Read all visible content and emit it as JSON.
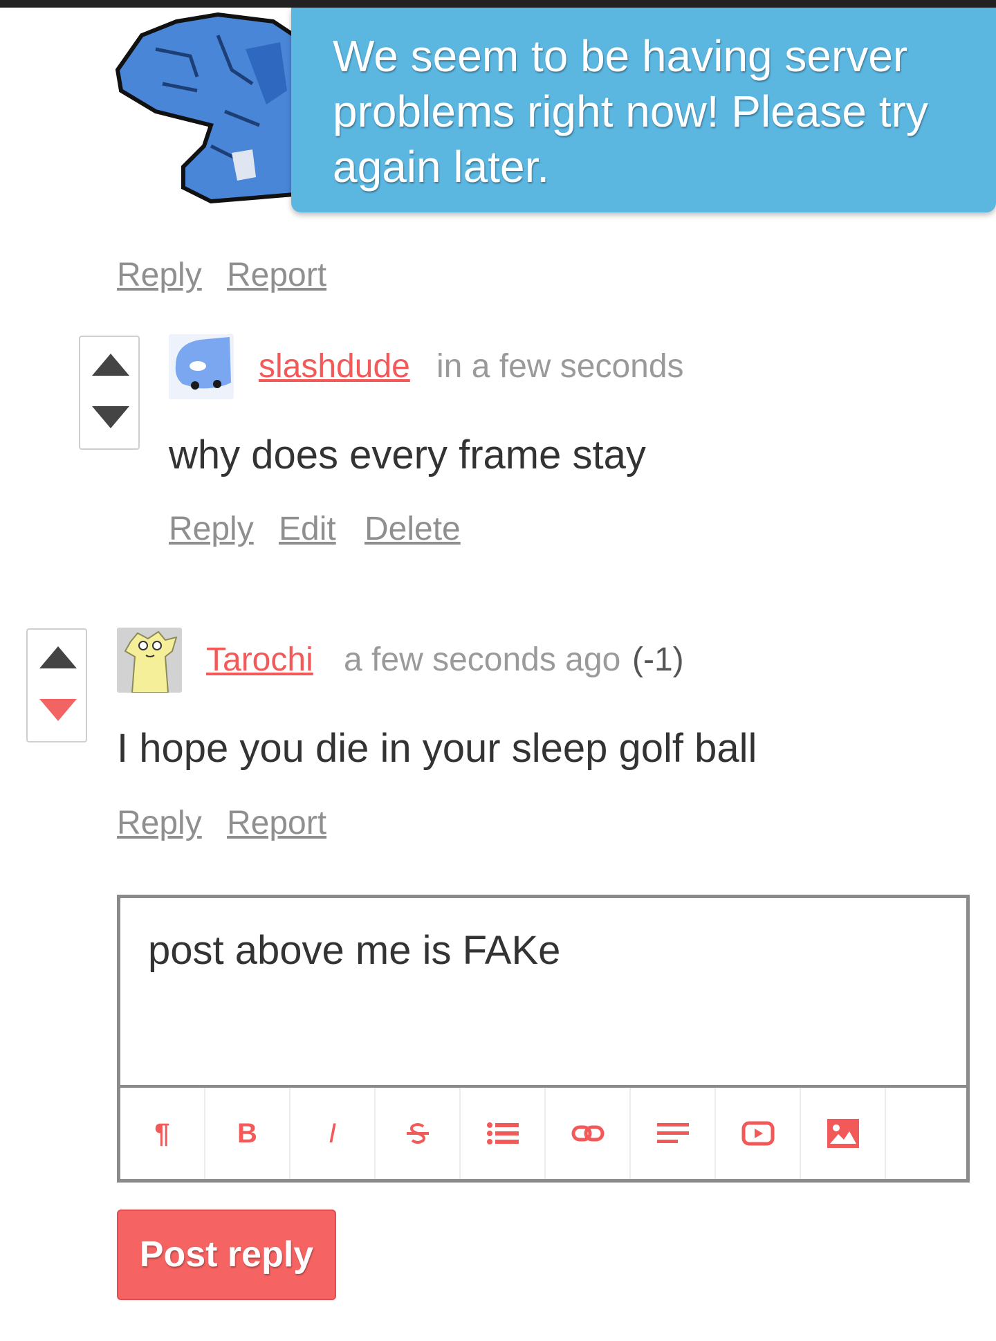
{
  "toast": {
    "message": "We seem to be having server problems right now! Please try again later."
  },
  "comment_prev": {
    "reply_label": "Reply",
    "report_label": "Report"
  },
  "comment_slashdude": {
    "username": "slashdude",
    "time": "in a few seconds",
    "text": "why does every frame stay",
    "reply_label": "Reply",
    "edit_label": "Edit",
    "delete_label": "Delete"
  },
  "comment_tarochi": {
    "username": "Tarochi",
    "time": "a few seconds ago",
    "score": "(-1)",
    "text": "I hope you die in your sleep golf ball",
    "reply_label": "Reply",
    "report_label": "Report"
  },
  "reply_box": {
    "value": "post above me is FAKe",
    "toolbar": [
      "paragraph-icon",
      "bold-icon",
      "italic-icon",
      "strikethrough-icon",
      "list-icon",
      "link-icon",
      "align-icon",
      "video-icon",
      "image-icon"
    ],
    "bold_glyph": "B",
    "italic_glyph": "I",
    "paragraph_glyph": "¶"
  },
  "post_button": {
    "label": "Post reply"
  },
  "colors": {
    "accent": "#f25a5a",
    "toast": "#5bb6e0",
    "muted": "#8f8f8f"
  }
}
